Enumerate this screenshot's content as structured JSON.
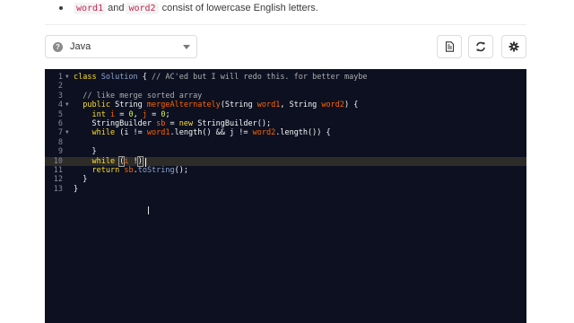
{
  "constraint": {
    "var1": "word1",
    "mid": "and",
    "var2": "word2",
    "rest": "consist of lowercase English letters."
  },
  "toolbar": {
    "language": "Java",
    "buttons": [
      "file-icon",
      "refresh-icon",
      "gear-icon"
    ]
  },
  "editor": {
    "lines": [
      {
        "num": "1",
        "fold": true,
        "tokens": [
          {
            "t": "class",
            "c": "kw"
          },
          {
            "t": " "
          },
          {
            "t": "Solution",
            "c": "cls"
          },
          {
            "t": " { "
          },
          {
            "t": "// AC'ed but I will redo this. for better maybe",
            "c": "cm"
          }
        ]
      },
      {
        "num": "2",
        "fold": false,
        "tokens": []
      },
      {
        "num": "3",
        "fold": false,
        "tokens": [
          {
            "t": "  "
          },
          {
            "t": "// like merge sorted array",
            "c": "cm"
          }
        ]
      },
      {
        "num": "4",
        "fold": true,
        "tokens": [
          {
            "t": "  "
          },
          {
            "t": "public",
            "c": "kw"
          },
          {
            "t": " String "
          },
          {
            "t": "mergeAlternately",
            "c": "vr"
          },
          {
            "t": "(String "
          },
          {
            "t": "word1",
            "c": "vr"
          },
          {
            "t": ", String "
          },
          {
            "t": "word2",
            "c": "vr"
          },
          {
            "t": ") {"
          }
        ]
      },
      {
        "num": "5",
        "fold": false,
        "tokens": [
          {
            "t": "    "
          },
          {
            "t": "int",
            "c": "kw"
          },
          {
            "t": " "
          },
          {
            "t": "i",
            "c": "vr"
          },
          {
            "t": " = "
          },
          {
            "t": "0",
            "c": "nm"
          },
          {
            "t": ", "
          },
          {
            "t": "j",
            "c": "vr"
          },
          {
            "t": " = "
          },
          {
            "t": "0",
            "c": "nm"
          },
          {
            "t": ";"
          }
        ]
      },
      {
        "num": "6",
        "fold": false,
        "tokens": [
          {
            "t": "    StringBuilder "
          },
          {
            "t": "sb",
            "c": "vr"
          },
          {
            "t": " = "
          },
          {
            "t": "new",
            "c": "kw"
          },
          {
            "t": " StringBuilder();"
          }
        ]
      },
      {
        "num": "7",
        "fold": true,
        "tokens": [
          {
            "t": "    "
          },
          {
            "t": "while",
            "c": "kw"
          },
          {
            "t": " (i != "
          },
          {
            "t": "word1",
            "c": "vr"
          },
          {
            "t": ".length() && j != "
          },
          {
            "t": "word2",
            "c": "vr"
          },
          {
            "t": ".length()) {"
          }
        ]
      },
      {
        "num": "8",
        "fold": false,
        "tokens": []
      },
      {
        "num": "9",
        "fold": false,
        "tokens": [
          {
            "t": "    }"
          }
        ]
      },
      {
        "num": "10",
        "fold": false,
        "active": true,
        "tokens": [
          {
            "t": "    "
          },
          {
            "t": "while",
            "c": "kw"
          },
          {
            "t": " "
          },
          {
            "t": "(",
            "c": "bracket"
          },
          {
            "t": "i",
            "c": "vr"
          },
          {
            "t": " !"
          },
          {
            "t": ")",
            "c": "bracket"
          }
        ]
      },
      {
        "num": "11",
        "fold": false,
        "tokens": [
          {
            "t": "    "
          },
          {
            "t": "return",
            "c": "kw"
          },
          {
            "t": " "
          },
          {
            "t": "sb",
            "c": "vr"
          },
          {
            "t": "."
          },
          {
            "t": "toString",
            "c": "cls"
          },
          {
            "t": "();"
          }
        ]
      },
      {
        "num": "12",
        "fold": false,
        "tokens": [
          {
            "t": "  }"
          }
        ]
      },
      {
        "num": "13",
        "fold": false,
        "tokens": [
          {
            "t": "}"
          }
        ]
      }
    ]
  }
}
